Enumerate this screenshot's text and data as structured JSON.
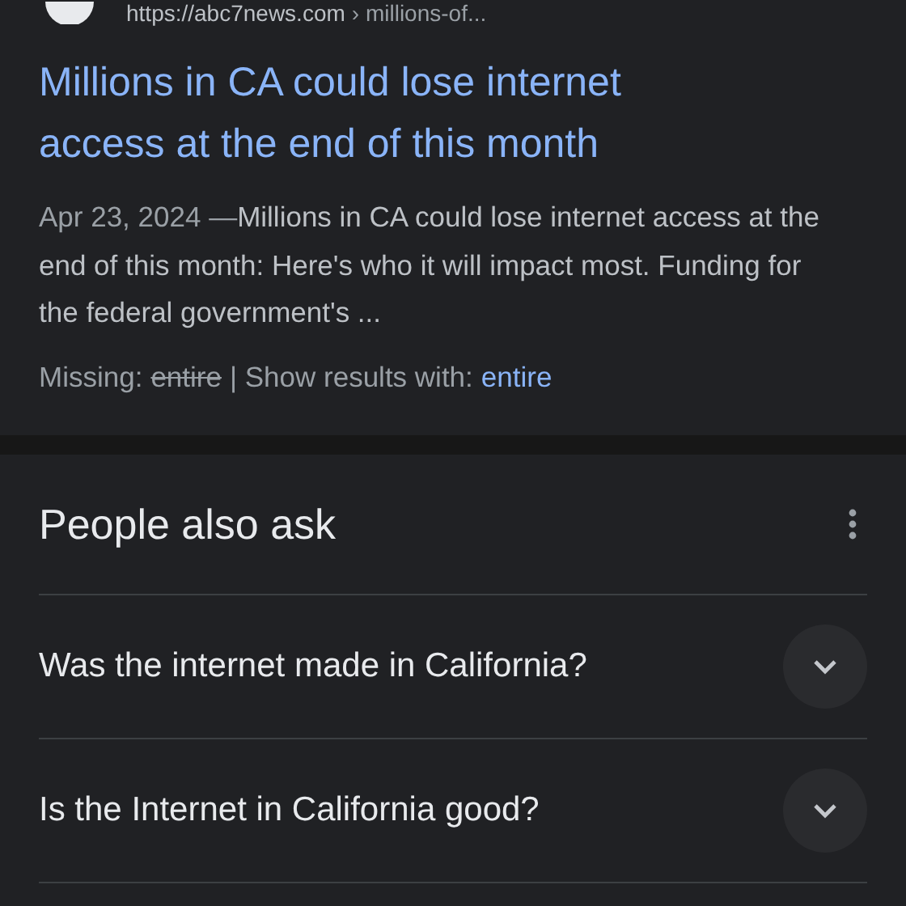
{
  "result": {
    "url": "https://abc7news.com",
    "breadcrumb": "› millions-of...",
    "title": "Millions in CA could lose internet access at the end of this month",
    "date": "Apr 23, 2024",
    "date_separator": "—",
    "snippet": "Millions in CA could lose internet access at the end of this month: Here's who it will impact most. Funding for the federal government's ...",
    "missing_label": "Missing:",
    "missing_term": "entire",
    "show_label": "| Show results with:",
    "show_term": "entire"
  },
  "people_also_ask": {
    "title": "People also ask",
    "questions": [
      {
        "text": "Was the internet made in California?",
        "expanded": false
      },
      {
        "text": "Is the Internet in California good?",
        "expanded": false
      }
    ]
  }
}
